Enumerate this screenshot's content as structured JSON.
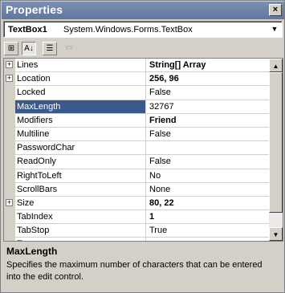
{
  "window": {
    "title": "Properties",
    "close_glyph": "×"
  },
  "selector": {
    "object_name": "TextBox1",
    "object_type": "System.Windows.Forms.TextBox",
    "arrow_glyph": "▼"
  },
  "toolbar": {
    "buttons": [
      {
        "icon": "categorized-icon",
        "glyph": "⊞"
      },
      {
        "icon": "alphabetical-icon",
        "glyph": "A↓"
      },
      {
        "icon": "properties-icon",
        "glyph": "☰"
      },
      {
        "icon": "events-icon",
        "glyph": "▭"
      }
    ]
  },
  "grid": {
    "rows": [
      {
        "name": "Lines",
        "value": "String[] Array",
        "expandable": true,
        "bold": true
      },
      {
        "name": "Location",
        "value": "256, 96",
        "expandable": true,
        "bold": true
      },
      {
        "name": "Locked",
        "value": "False"
      },
      {
        "name": "MaxLength",
        "value": "32767",
        "selected": true
      },
      {
        "name": "Modifiers",
        "value": "Friend",
        "bold": true
      },
      {
        "name": "Multiline",
        "value": "False"
      },
      {
        "name": "PasswordChar",
        "value": ""
      },
      {
        "name": "ReadOnly",
        "value": "False"
      },
      {
        "name": "RightToLeft",
        "value": "No"
      },
      {
        "name": "ScrollBars",
        "value": "None"
      },
      {
        "name": "Size",
        "value": "80, 22",
        "expandable": true,
        "bold": true
      },
      {
        "name": "TabIndex",
        "value": "1",
        "bold": true
      },
      {
        "name": "TabStop",
        "value": "True"
      },
      {
        "name": "Tag",
        "value": ""
      }
    ],
    "expander_glyph": "+",
    "scroll_up_glyph": "▲",
    "scroll_down_glyph": "▼"
  },
  "description": {
    "heading": "MaxLength",
    "text": "Specifies the maximum number of characters that can be entered into the edit control."
  }
}
